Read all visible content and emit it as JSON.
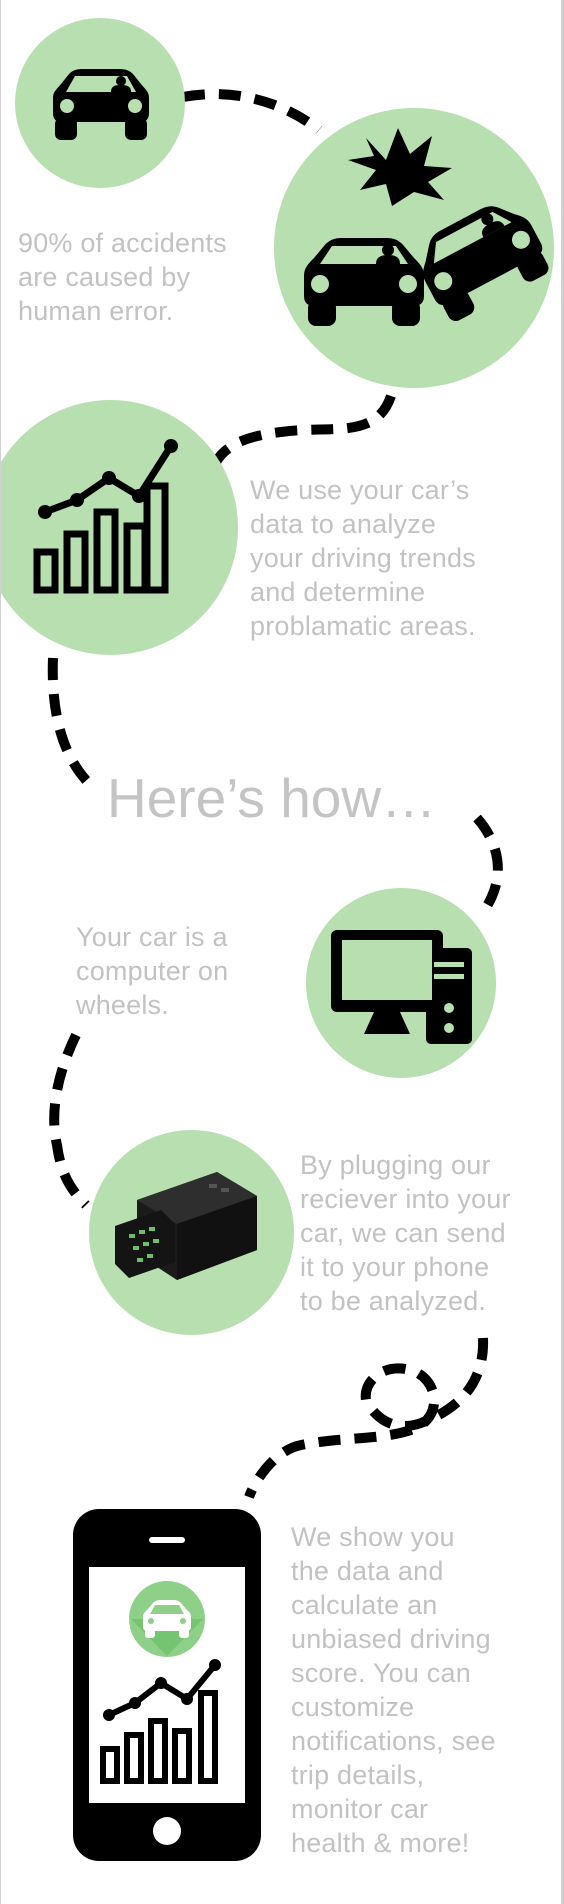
{
  "colors": {
    "circle": "#b7dfb0",
    "text": "#c2c2c2",
    "icon": "#000000",
    "background": "#ffffff"
  },
  "sections": {
    "accidents": {
      "text": "90% of accidents\nare caused by\nhuman error.",
      "icons": [
        "car-icon",
        "car-crash-icon"
      ]
    },
    "analyze": {
      "text": "We use your car’s\ndata to analyze\nyour driving trends\nand determine\nproblamatic areas.",
      "icons": [
        "chart-icon"
      ]
    },
    "heading": {
      "text": "Here’s how…"
    },
    "computer": {
      "text": "Your car is a\ncomputer on\nwheels.",
      "icons": [
        "computer-icon"
      ]
    },
    "receiver": {
      "text": "By plugging our\nreciever into your\ncar, we can send\nit to your phone\nto be analyzed.",
      "icons": [
        "obd-receiver-icon"
      ]
    },
    "phone": {
      "text": "We show you\nthe data and\ncalculate an\nunbiased driving\nscore. You can\ncustomize\nnotifications, see\ntrip details,\nmonitor car\nhealth & more!",
      "icons": [
        "smartphone-icon"
      ]
    }
  }
}
